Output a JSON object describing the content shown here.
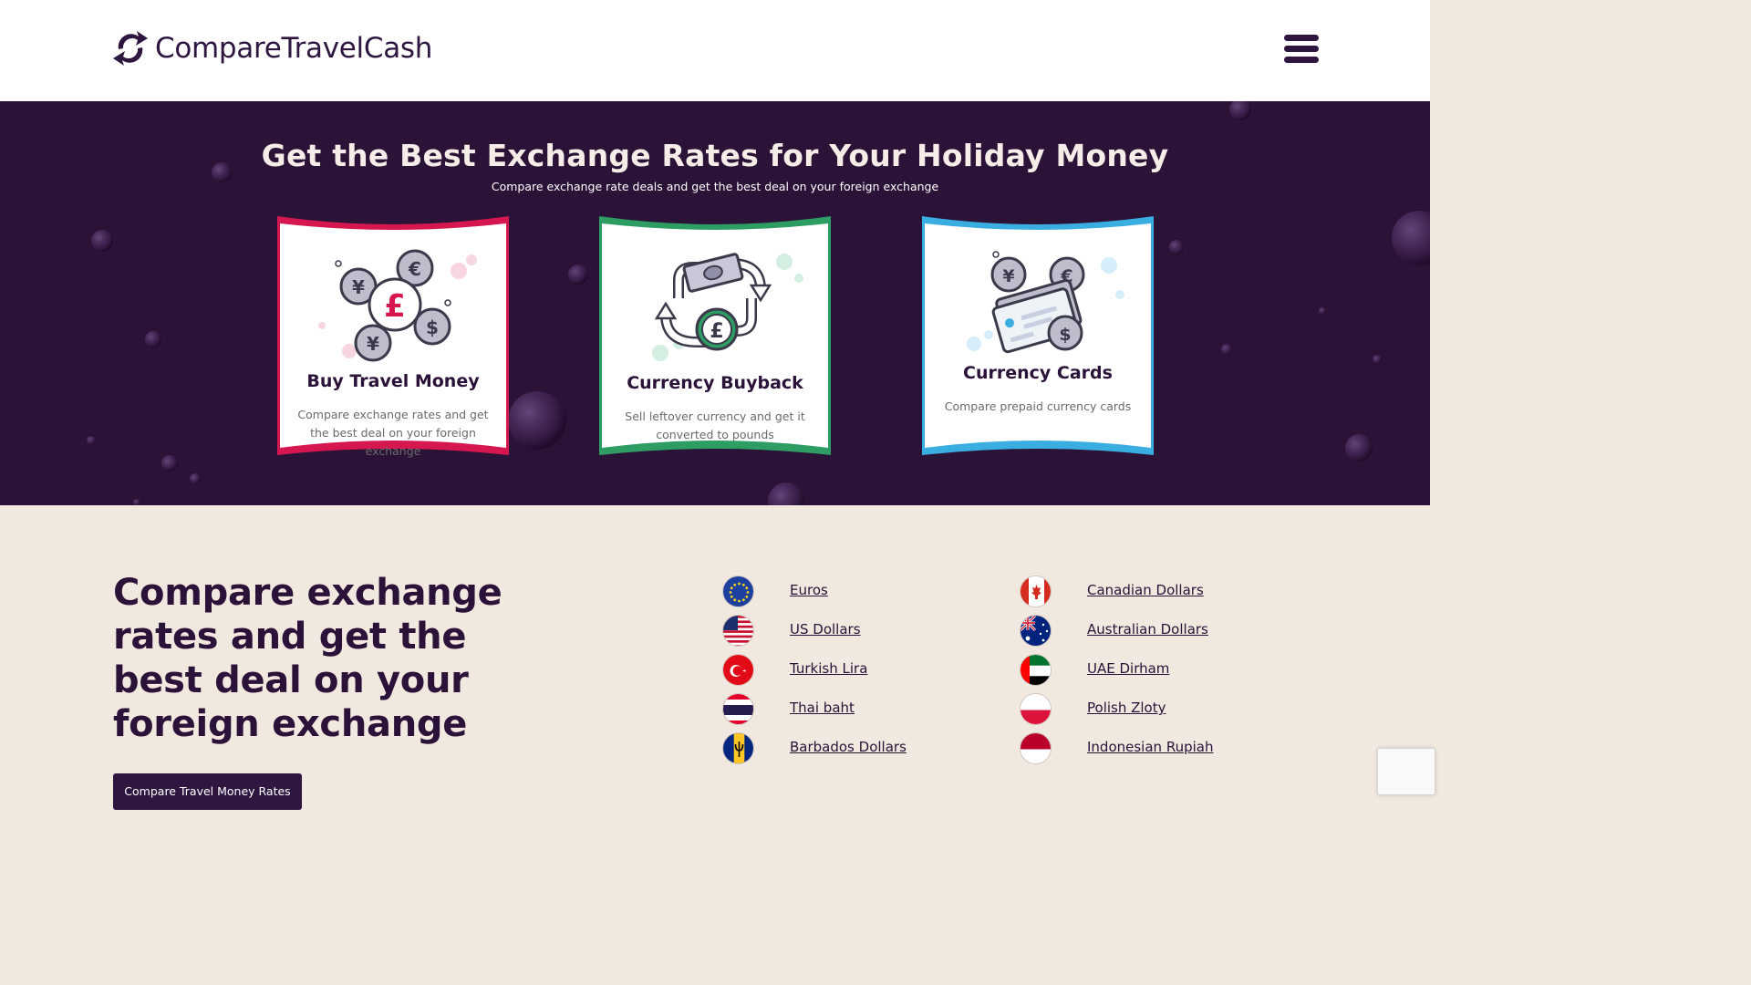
{
  "header": {
    "logo_text": "CompareTravelCash",
    "menu_icon": "hamburger-menu-icon"
  },
  "hero": {
    "title": "Get the Best Exchange Rates for Your Holiday Money",
    "subtitle": "Compare exchange rate deals and get the best deal on your foreign exchange",
    "cards": [
      {
        "title": "Buy Travel Money",
        "description": "Compare exchange rates and get the best deal on your foreign exchange",
        "accent": "#d6174f",
        "icon": "coins-icon"
      },
      {
        "title": "Currency Buyback",
        "description": "Sell leftover currency and get it converted to pounds",
        "accent": "#2e9d63",
        "icon": "currency-exchange-icon"
      },
      {
        "title": "Currency Cards",
        "description": "Compare prepaid currency cards",
        "accent": "#3aaee0",
        "icon": "prepaid-card-icon"
      }
    ]
  },
  "main": {
    "heading": "Compare exchange rates and get the best deal on your foreign exchange",
    "cta_label": "Compare Travel Money Rates",
    "currencies_left": [
      {
        "label": "Euros",
        "flag": "eu-flag-icon"
      },
      {
        "label": "US Dollars",
        "flag": "us-flag-icon"
      },
      {
        "label": "Turkish Lira",
        "flag": "turkey-flag-icon"
      },
      {
        "label": "Thai baht",
        "flag": "thailand-flag-icon"
      },
      {
        "label": "Barbados Dollars",
        "flag": "barbados-flag-icon"
      }
    ],
    "currencies_right": [
      {
        "label": "Canadian Dollars",
        "flag": "canada-flag-icon"
      },
      {
        "label": "Australian Dollars",
        "flag": "australia-flag-icon"
      },
      {
        "label": "UAE Dirham",
        "flag": "uae-flag-icon"
      },
      {
        "label": "Polish Zloty",
        "flag": "poland-flag-icon"
      },
      {
        "label": "Indonesian Rupiah",
        "flag": "indonesia-flag-icon"
      }
    ]
  },
  "colors": {
    "brand_dark": "#2e1640",
    "hero_bg": "#2b1338",
    "section_bg": "#f1e8df"
  }
}
